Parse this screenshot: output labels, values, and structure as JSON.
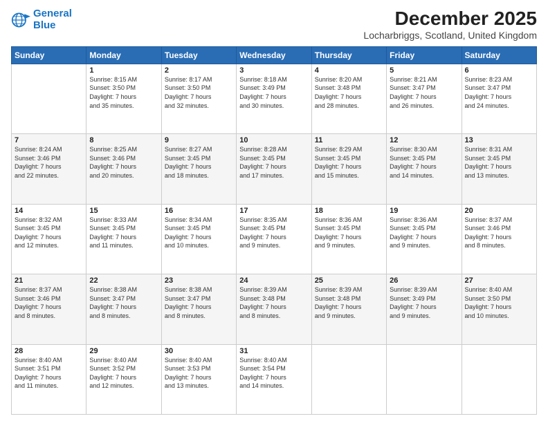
{
  "logo": {
    "line1": "General",
    "line2": "Blue"
  },
  "title": "December 2025",
  "subtitle": "Locharbriggs, Scotland, United Kingdom",
  "days_of_week": [
    "Sunday",
    "Monday",
    "Tuesday",
    "Wednesday",
    "Thursday",
    "Friday",
    "Saturday"
  ],
  "weeks": [
    [
      {
        "day": "",
        "info": ""
      },
      {
        "day": "1",
        "info": "Sunrise: 8:15 AM\nSunset: 3:50 PM\nDaylight: 7 hours\nand 35 minutes."
      },
      {
        "day": "2",
        "info": "Sunrise: 8:17 AM\nSunset: 3:50 PM\nDaylight: 7 hours\nand 32 minutes."
      },
      {
        "day": "3",
        "info": "Sunrise: 8:18 AM\nSunset: 3:49 PM\nDaylight: 7 hours\nand 30 minutes."
      },
      {
        "day": "4",
        "info": "Sunrise: 8:20 AM\nSunset: 3:48 PM\nDaylight: 7 hours\nand 28 minutes."
      },
      {
        "day": "5",
        "info": "Sunrise: 8:21 AM\nSunset: 3:47 PM\nDaylight: 7 hours\nand 26 minutes."
      },
      {
        "day": "6",
        "info": "Sunrise: 8:23 AM\nSunset: 3:47 PM\nDaylight: 7 hours\nand 24 minutes."
      }
    ],
    [
      {
        "day": "7",
        "info": "Sunrise: 8:24 AM\nSunset: 3:46 PM\nDaylight: 7 hours\nand 22 minutes."
      },
      {
        "day": "8",
        "info": "Sunrise: 8:25 AM\nSunset: 3:46 PM\nDaylight: 7 hours\nand 20 minutes."
      },
      {
        "day": "9",
        "info": "Sunrise: 8:27 AM\nSunset: 3:45 PM\nDaylight: 7 hours\nand 18 minutes."
      },
      {
        "day": "10",
        "info": "Sunrise: 8:28 AM\nSunset: 3:45 PM\nDaylight: 7 hours\nand 17 minutes."
      },
      {
        "day": "11",
        "info": "Sunrise: 8:29 AM\nSunset: 3:45 PM\nDaylight: 7 hours\nand 15 minutes."
      },
      {
        "day": "12",
        "info": "Sunrise: 8:30 AM\nSunset: 3:45 PM\nDaylight: 7 hours\nand 14 minutes."
      },
      {
        "day": "13",
        "info": "Sunrise: 8:31 AM\nSunset: 3:45 PM\nDaylight: 7 hours\nand 13 minutes."
      }
    ],
    [
      {
        "day": "14",
        "info": "Sunrise: 8:32 AM\nSunset: 3:45 PM\nDaylight: 7 hours\nand 12 minutes."
      },
      {
        "day": "15",
        "info": "Sunrise: 8:33 AM\nSunset: 3:45 PM\nDaylight: 7 hours\nand 11 minutes."
      },
      {
        "day": "16",
        "info": "Sunrise: 8:34 AM\nSunset: 3:45 PM\nDaylight: 7 hours\nand 10 minutes."
      },
      {
        "day": "17",
        "info": "Sunrise: 8:35 AM\nSunset: 3:45 PM\nDaylight: 7 hours\nand 9 minutes."
      },
      {
        "day": "18",
        "info": "Sunrise: 8:36 AM\nSunset: 3:45 PM\nDaylight: 7 hours\nand 9 minutes."
      },
      {
        "day": "19",
        "info": "Sunrise: 8:36 AM\nSunset: 3:45 PM\nDaylight: 7 hours\nand 9 minutes."
      },
      {
        "day": "20",
        "info": "Sunrise: 8:37 AM\nSunset: 3:46 PM\nDaylight: 7 hours\nand 8 minutes."
      }
    ],
    [
      {
        "day": "21",
        "info": "Sunrise: 8:37 AM\nSunset: 3:46 PM\nDaylight: 7 hours\nand 8 minutes."
      },
      {
        "day": "22",
        "info": "Sunrise: 8:38 AM\nSunset: 3:47 PM\nDaylight: 7 hours\nand 8 minutes."
      },
      {
        "day": "23",
        "info": "Sunrise: 8:38 AM\nSunset: 3:47 PM\nDaylight: 7 hours\nand 8 minutes."
      },
      {
        "day": "24",
        "info": "Sunrise: 8:39 AM\nSunset: 3:48 PM\nDaylight: 7 hours\nand 8 minutes."
      },
      {
        "day": "25",
        "info": "Sunrise: 8:39 AM\nSunset: 3:48 PM\nDaylight: 7 hours\nand 9 minutes."
      },
      {
        "day": "26",
        "info": "Sunrise: 8:39 AM\nSunset: 3:49 PM\nDaylight: 7 hours\nand 9 minutes."
      },
      {
        "day": "27",
        "info": "Sunrise: 8:40 AM\nSunset: 3:50 PM\nDaylight: 7 hours\nand 10 minutes."
      }
    ],
    [
      {
        "day": "28",
        "info": "Sunrise: 8:40 AM\nSunset: 3:51 PM\nDaylight: 7 hours\nand 11 minutes."
      },
      {
        "day": "29",
        "info": "Sunrise: 8:40 AM\nSunset: 3:52 PM\nDaylight: 7 hours\nand 12 minutes."
      },
      {
        "day": "30",
        "info": "Sunrise: 8:40 AM\nSunset: 3:53 PM\nDaylight: 7 hours\nand 13 minutes."
      },
      {
        "day": "31",
        "info": "Sunrise: 8:40 AM\nSunset: 3:54 PM\nDaylight: 7 hours\nand 14 minutes."
      },
      {
        "day": "",
        "info": ""
      },
      {
        "day": "",
        "info": ""
      },
      {
        "day": "",
        "info": ""
      }
    ]
  ]
}
